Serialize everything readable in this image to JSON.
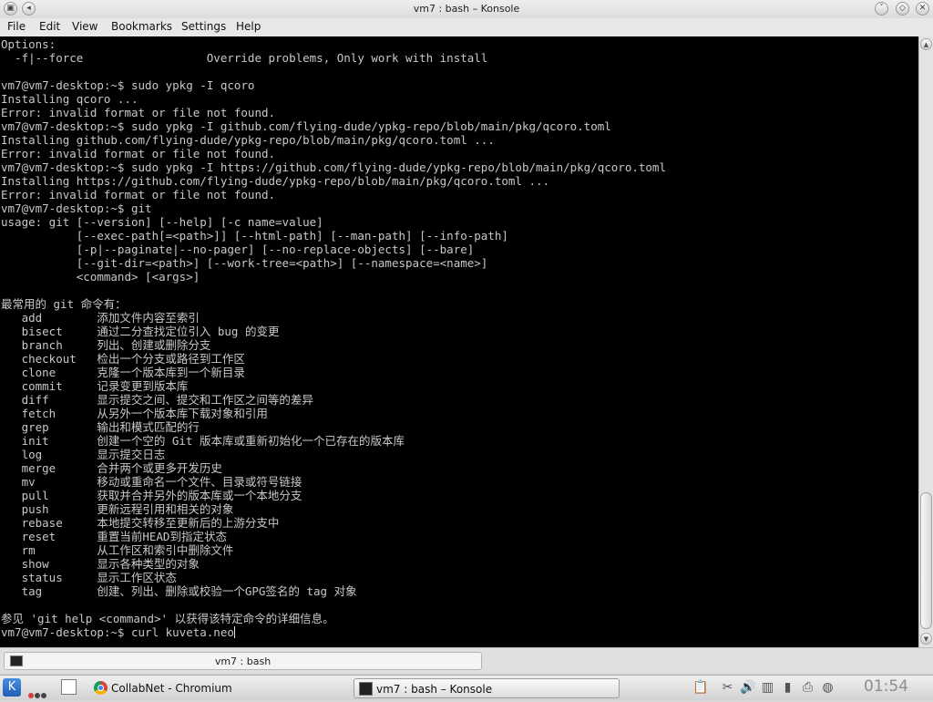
{
  "window": {
    "title": "vm7 : bash – Konsole",
    "buttons": {
      "help": "?",
      "minimize": "˅",
      "maximize": "◇",
      "close": "✕"
    }
  },
  "menubar": {
    "items": [
      "File",
      "Edit",
      "View",
      "Bookmarks",
      "Settings",
      "Help"
    ]
  },
  "terminal": {
    "lines": [
      "Options:",
      "  -f|--force                  Override problems, Only work with install",
      "",
      "vm7@vm7-desktop:~$ sudo ypkg -I qcoro",
      "Installing qcoro ...",
      "Error: invalid format or file not found.",
      "vm7@vm7-desktop:~$ sudo ypkg -I github.com/flying-dude/ypkg-repo/blob/main/pkg/qcoro.toml",
      "Installing github.com/flying-dude/ypkg-repo/blob/main/pkg/qcoro.toml ...",
      "Error: invalid format or file not found.",
      "vm7@vm7-desktop:~$ sudo ypkg -I https://github.com/flying-dude/ypkg-repo/blob/main/pkg/qcoro.toml",
      "Installing https://github.com/flying-dude/ypkg-repo/blob/main/pkg/qcoro.toml ...",
      "Error: invalid format or file not found.",
      "vm7@vm7-desktop:~$ git",
      "usage: git [--version] [--help] [-c name=value]",
      "           [--exec-path[=<path>]] [--html-path] [--man-path] [--info-path]",
      "           [-p|--paginate|--no-pager] [--no-replace-objects] [--bare]",
      "           [--git-dir=<path>] [--work-tree=<path>] [--namespace=<name>]",
      "           <command> [<args>]",
      "",
      "最常用的 git 命令有：",
      "   add        添加文件内容至索引",
      "   bisect     通过二分查找定位引入 bug 的变更",
      "   branch     列出、创建或删除分支",
      "   checkout   检出一个分支或路径到工作区",
      "   clone      克隆一个版本库到一个新目录",
      "   commit     记录变更到版本库",
      "   diff       显示提交之间、提交和工作区之间等的差异",
      "   fetch      从另外一个版本库下载对象和引用",
      "   grep       输出和模式匹配的行",
      "   init       创建一个空的 Git 版本库或重新初始化一个已存在的版本库",
      "   log        显示提交日志",
      "   merge      合并两个或更多开发历史",
      "   mv         移动或重命名一个文件、目录或符号链接",
      "   pull       获取并合并另外的版本库或一个本地分支",
      "   push       更新远程引用和相关的对象",
      "   rebase     本地提交转移至更新后的上游分支中",
      "   reset      重置当前HEAD到指定状态",
      "   rm         从工作区和索引中删除文件",
      "   show       显示各种类型的对象",
      "   status     显示工作区状态",
      "   tag        创建、列出、删除或校验一个GPG签名的 tag 对象",
      "",
      "参见 'git help <command>' 以获得该特定命令的详细信息。"
    ],
    "prompt_line": "vm7@vm7-desktop:~$ curl kuveta.neo"
  },
  "session_tab": {
    "label": "vm7 : bash"
  },
  "taskbar": {
    "tasks": [
      {
        "label": "CollabNet - Chromium",
        "icon": "chromium-icon"
      },
      {
        "label": "vm7 : bash – Konsole",
        "icon": "konsole-icon"
      }
    ],
    "pager_colors": [
      "#d73a3a",
      "#444444",
      "#444444"
    ],
    "tray_icons": [
      "clipboard-icon",
      "network-icon",
      "volume-icon",
      "package-updater-icon",
      "battery-icon",
      "printer-icon",
      "globe-icon"
    ],
    "clock": "01:54"
  },
  "colors": {
    "terminal_background": "#000000",
    "terminal_foreground": "#c8c8c8",
    "kde_blue": "#1d5fb4"
  }
}
